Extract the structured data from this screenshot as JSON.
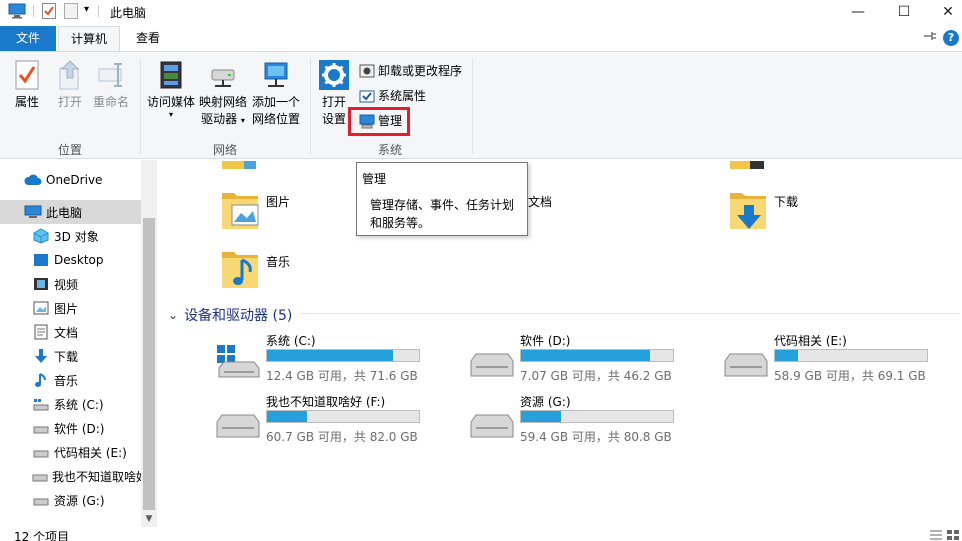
{
  "window": {
    "title": "此电脑",
    "minimize": "—",
    "maximize": "☐",
    "close": "✕"
  },
  "tabs": {
    "file": "文件",
    "computer": "计算机",
    "view": "查看"
  },
  "ribbon": {
    "location_group": "位置",
    "network_group": "网络",
    "system_group": "系统",
    "properties": "属性",
    "open": "打开",
    "rename": "重命名",
    "access_media": "访问媒体",
    "map_drive_line1": "映射网络",
    "map_drive_line2": "驱动器",
    "add_location_line1": "添加一个",
    "add_location_line2": "网络位置",
    "open_settings_line1": "打开",
    "open_settings_line2": "设置",
    "uninstall": "卸载或更改程序",
    "system_properties": "系统属性",
    "manage": "管理"
  },
  "tooltip": {
    "title": "管理",
    "body": "管理存储、事件、任务计划和服务等。"
  },
  "nav": {
    "items": [
      {
        "label": "OneDrive"
      },
      {
        "label": "此电脑"
      },
      {
        "label": "3D 对象"
      },
      {
        "label": "Desktop"
      },
      {
        "label": "视频"
      },
      {
        "label": "图片"
      },
      {
        "label": "文档"
      },
      {
        "label": "下载"
      },
      {
        "label": "音乐"
      },
      {
        "label": "系统 (C:)"
      },
      {
        "label": "软件 (D:)"
      },
      {
        "label": "代码相关 (E:)"
      },
      {
        "label": "我也不知道取啥好"
      },
      {
        "label": "资源 (G:)"
      }
    ]
  },
  "folders": {
    "pictures": "图片",
    "documents": "文档",
    "downloads": "下载",
    "music": "音乐"
  },
  "devices_header": "设备和驱动器 (5)",
  "drives": [
    {
      "name": "系统 (C:)",
      "info": "12.4 GB 可用，共 71.6 GB",
      "used_fraction": 0.83
    },
    {
      "name": "软件 (D:)",
      "info": "7.07 GB 可用，共 46.2 GB",
      "used_fraction": 0.85
    },
    {
      "name": "代码相关 (E:)",
      "info": "58.9 GB 可用，共 69.1 GB",
      "used_fraction": 0.15
    },
    {
      "name": "我也不知道取啥好 (F:)",
      "info": "60.7 GB 可用，共 82.0 GB",
      "used_fraction": 0.26
    },
    {
      "name": "资源 (G:)",
      "info": "59.4 GB 可用，共 80.8 GB",
      "used_fraction": 0.26
    }
  ],
  "status": {
    "items": "12 个项目"
  },
  "colors": {
    "accent": "#1979ca",
    "drive_bar": "#26a0da",
    "highlight": "#e0202a"
  }
}
